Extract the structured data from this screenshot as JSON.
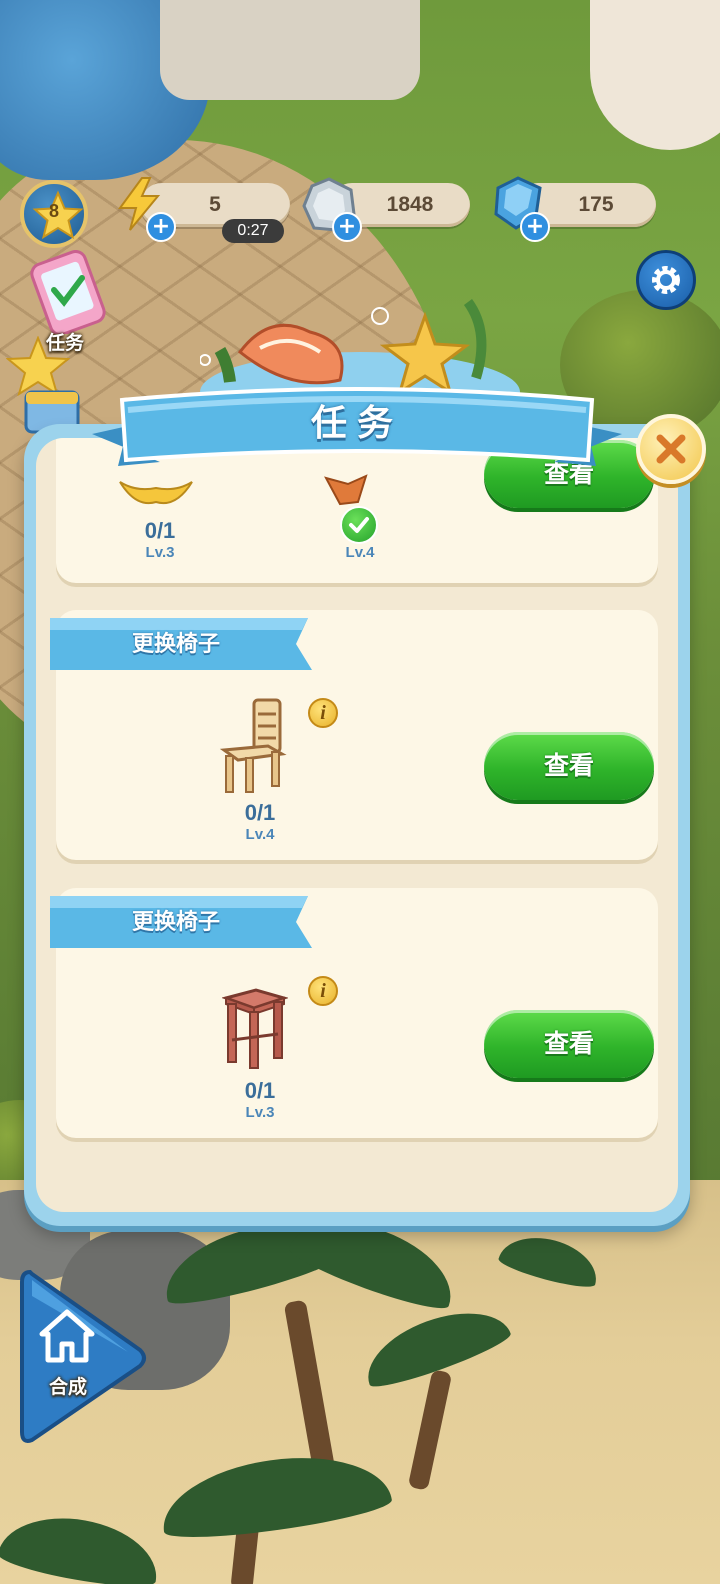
{
  "hud": {
    "player_level": "8",
    "energy": "5",
    "energy_timer": "0:27",
    "coins": "1848",
    "gems": "175"
  },
  "left_menu": {
    "task_label": "任务"
  },
  "panel": {
    "title": "任务",
    "partial_card": {
      "items": [
        {
          "progress": "0/1",
          "level": "Lv.3"
        },
        {
          "progress": "",
          "level": "Lv.4",
          "completed": true
        }
      ],
      "button_label": "查看"
    },
    "cards": [
      {
        "title": "更换椅子",
        "progress": "0/1",
        "level": "Lv.4",
        "item_icon": "wooden-chair-icon",
        "button_label": "查看"
      },
      {
        "title": "更换椅子",
        "progress": "0/1",
        "level": "Lv.3",
        "item_icon": "red-stool-icon",
        "button_label": "查看"
      }
    ]
  },
  "bottom_nav": {
    "home_label": "合成"
  },
  "colors": {
    "panel_frame": "#9cd3ec",
    "panel_bg": "#f3e9d3",
    "ribbon_blue": "#5ab8e6",
    "button_green": "#2fb42a",
    "text_blue": "#3b6e9a",
    "gold": "#f2c64b"
  }
}
